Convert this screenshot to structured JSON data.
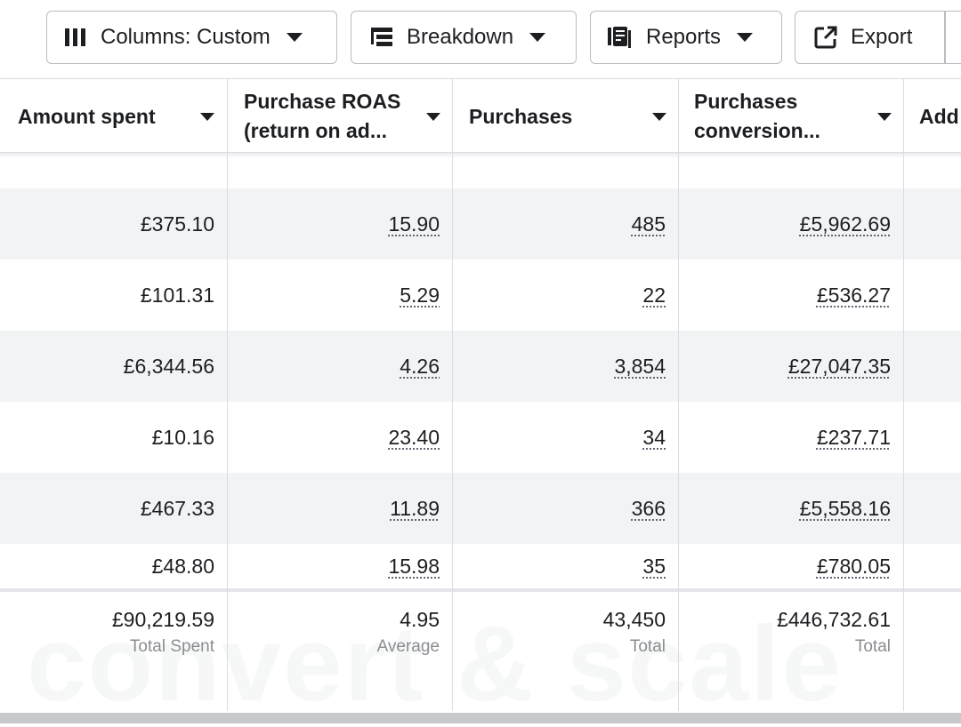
{
  "toolbar": {
    "columns_label": "Columns: Custom",
    "breakdown_label": "Breakdown",
    "reports_label": "Reports",
    "export_label": "Export"
  },
  "table": {
    "headers": [
      {
        "line1": "Amount spent",
        "line2": ""
      },
      {
        "line1": "Purchase ROAS",
        "line2": "(return on ad..."
      },
      {
        "line1": "Purchases",
        "line2": ""
      },
      {
        "line1": "Purchases",
        "line2": "conversion..."
      },
      {
        "line1": "Add",
        "line2": ""
      }
    ],
    "rows": [
      {
        "spent": "£375.10",
        "roas": "15.90",
        "purchases": "485",
        "conv": "£5,962.69"
      },
      {
        "spent": "£101.31",
        "roas": "5.29",
        "purchases": "22",
        "conv": "£536.27"
      },
      {
        "spent": "£6,344.56",
        "roas": "4.26",
        "purchases": "3,854",
        "conv": "£27,047.35"
      },
      {
        "spent": "£10.16",
        "roas": "23.40",
        "purchases": "34",
        "conv": "£237.71"
      },
      {
        "spent": "£467.33",
        "roas": "11.89",
        "purchases": "366",
        "conv": "£5,558.16"
      },
      {
        "spent": "£48.80",
        "roas": "15.98",
        "purchases": "35",
        "conv": "£780.05"
      }
    ],
    "totals": [
      {
        "value": "£90,219.59",
        "label": "Total Spent"
      },
      {
        "value": "4.95",
        "label": "Average"
      },
      {
        "value": "43,450",
        "label": "Total"
      },
      {
        "value": "£446,732.61",
        "label": "Total"
      }
    ]
  },
  "watermark": "convert & scale"
}
